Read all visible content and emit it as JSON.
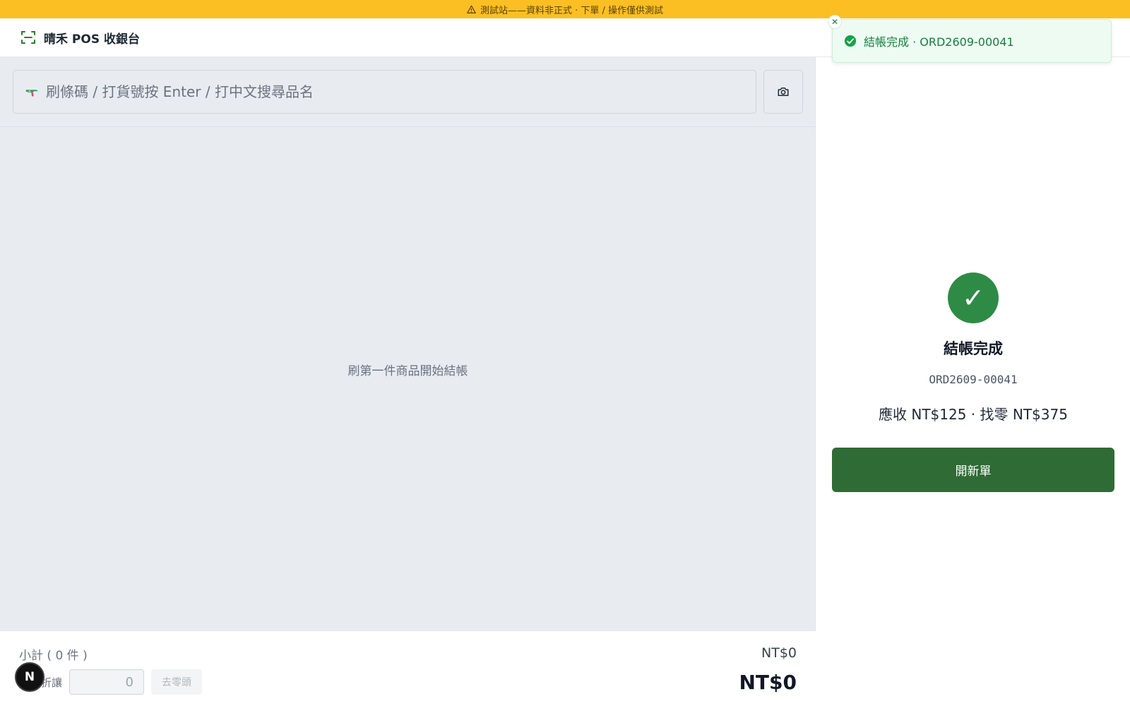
{
  "banner": {
    "text": "測試站——資料非正式 · 下單 / 操作僅供測試",
    "icon": "warning-icon",
    "color": "#fbbf24"
  },
  "header": {
    "title": "晴禾 POS 收銀台",
    "icon": "scan-frame-icon",
    "accent": "#2e7d32"
  },
  "search": {
    "placeholder": "刷條碼 / 打貨號按 Enter / 打中文搜尋品名",
    "icon": "scanner-gun-icon",
    "camera_icon": "camera-icon"
  },
  "cart": {
    "empty_message": "刷第一件商品開始結帳"
  },
  "totals": {
    "subtotal_label": "小計 ( 0 件 )",
    "subtotal_value": "NT$0",
    "discount_label": "折讓",
    "discount_value": "0",
    "round_button": "去零頭",
    "total_value": "NT$0"
  },
  "checkout": {
    "title": "結帳完成",
    "order_no": "ORD2609-00041",
    "summary": "應收 NT$125 · 找零 NT$375",
    "new_order_button": "開新單",
    "success_color": "#2e8b45",
    "button_color": "#2f6b35"
  },
  "toast": {
    "text": "結帳完成 · ORD2609-00041",
    "icon": "check-circle-icon",
    "close_icon": "close-icon"
  },
  "dev_badge": {
    "label": "N"
  }
}
